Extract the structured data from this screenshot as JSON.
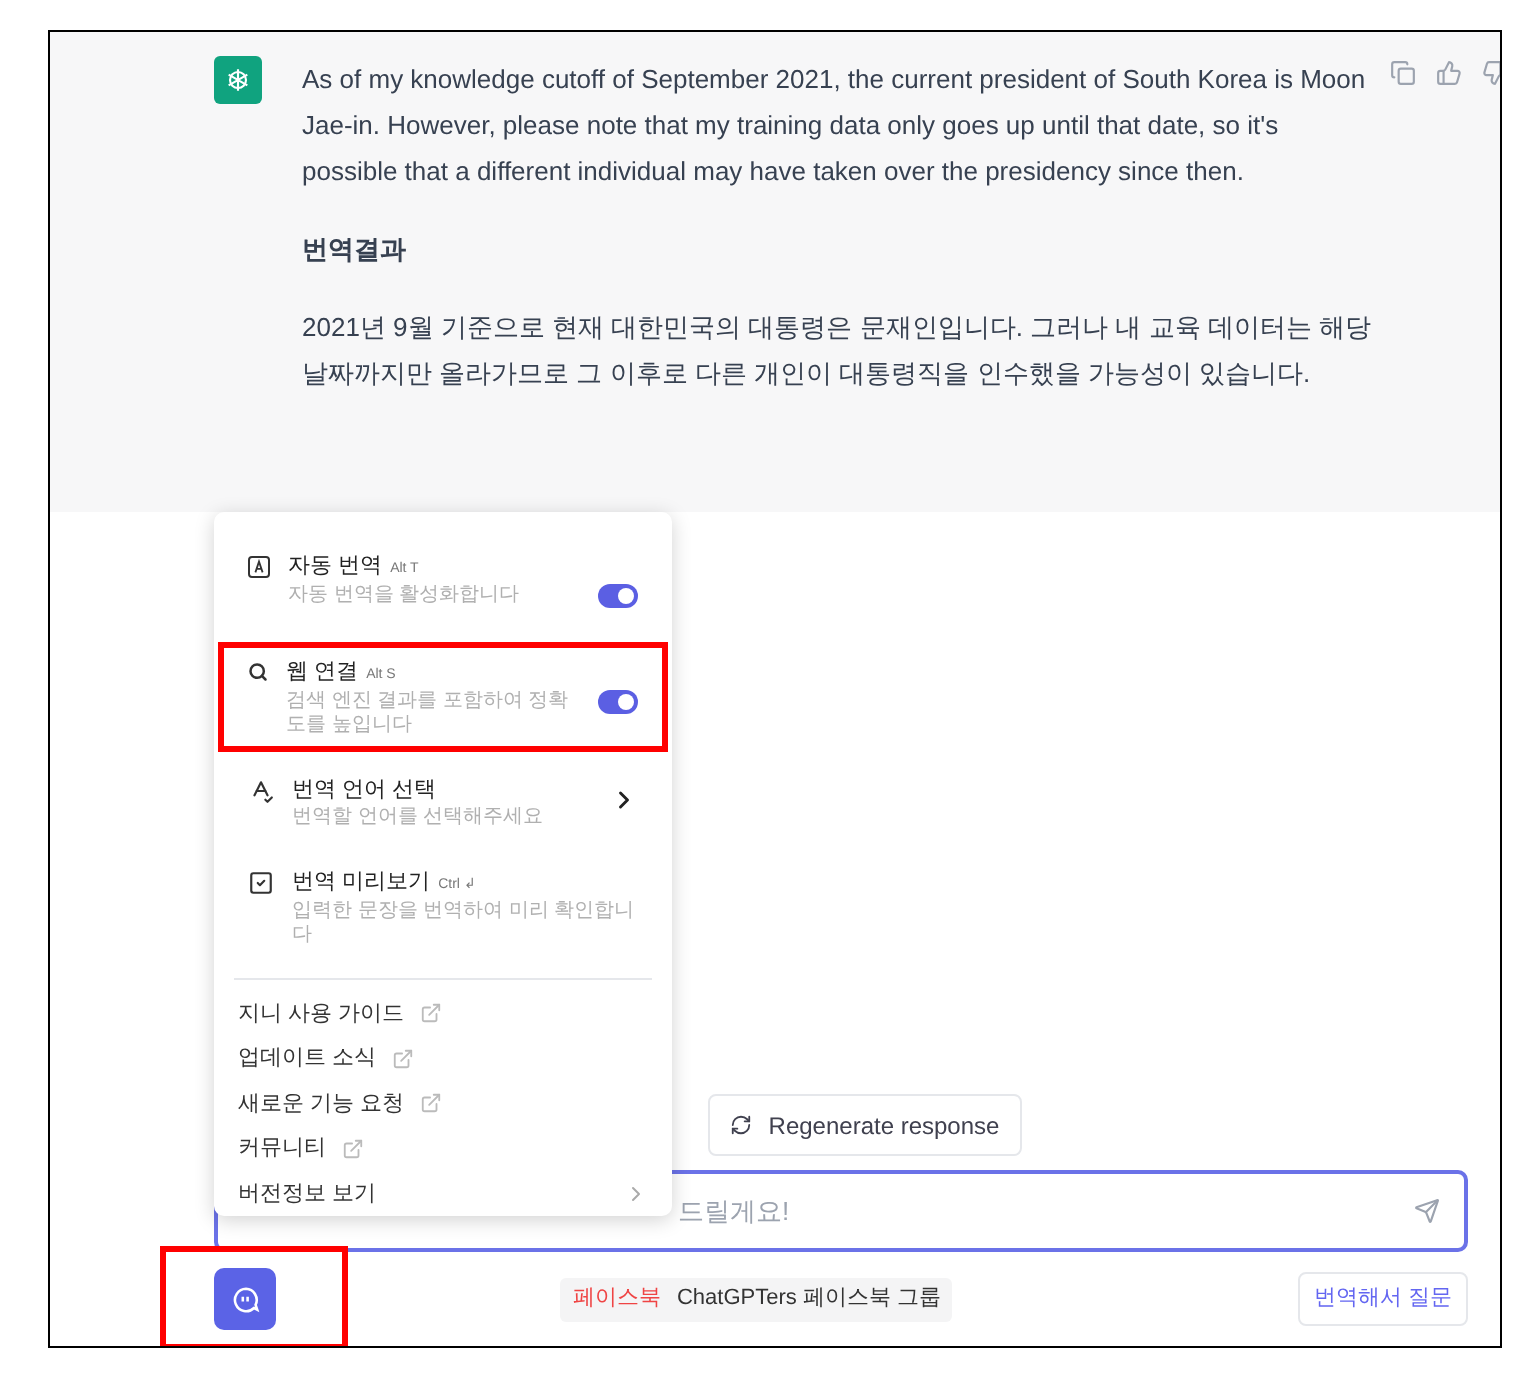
{
  "response": {
    "paragraphs": [
      "As of my knowledge cutoff of September 2021, the current president of South Korea is Moon Jae-in. However, please note that my training data only goes up until that date, so it's possible that a different individual may have taken over the presidency since then."
    ],
    "translation_heading": "번역결과",
    "translation": "2021년 9월 기준으로 현재 대한민국의 대통령은 문재인입니다. 그러나 내 교육 데이터는 해당 날짜까지만 올라가므로 그 이후로 다른 개인이 대통령직을 인수했을 가능성이 있습니다."
  },
  "menu": {
    "settings": [
      {
        "kind": "toggle",
        "title": "자동 번역",
        "shortcut": "Alt T",
        "description": "자동 번역을 활성화합니다",
        "on": true,
        "highlighted": false
      },
      {
        "kind": "toggle",
        "title": "웹 연결",
        "shortcut": "Alt S",
        "description": "검색 엔진 결과를 포함하여 정확도를 높입니다",
        "on": true,
        "highlighted": true
      },
      {
        "kind": "submenu",
        "title": "번역 언어 선택",
        "description": "번역할 언어를 선택해주세요",
        "highlighted": false
      },
      {
        "kind": "plain",
        "title": "번역 미리보기",
        "shortcut": "Ctrl ↲",
        "description": "입력한 문장을 번역하여 미리 확인합니다",
        "highlighted": false
      }
    ],
    "links": [
      {
        "kind": "external",
        "label": "지니 사용 가이드"
      },
      {
        "kind": "external",
        "label": "업데이트 소식"
      },
      {
        "kind": "external",
        "label": "새로운 기능 요청"
      },
      {
        "kind": "external",
        "label": "커뮤니티"
      },
      {
        "kind": "submenu",
        "label": "버전정보 보기"
      }
    ]
  },
  "regenerate_button": "Regenerate response",
  "input": {
    "placeholder": "드릴게요!"
  },
  "footer": {
    "assistant_button_highlighted": true,
    "tag": "페이스북",
    "group": "ChatGPTers 페이스북 그룹",
    "translate_button": "번역해서 질문"
  }
}
